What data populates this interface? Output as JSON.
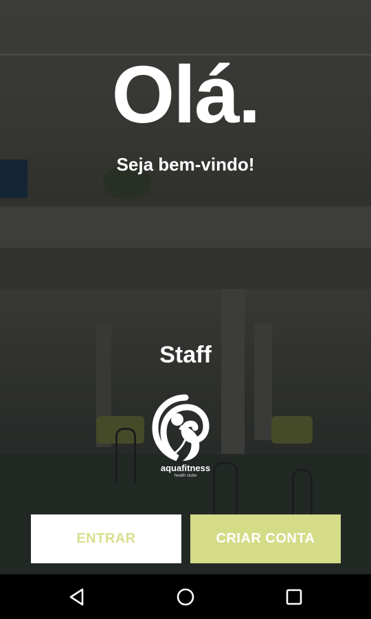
{
  "greeting": "Olá.",
  "welcome": "Seja bem-vindo!",
  "staff_label": "Staff",
  "logo": {
    "name": "aquafitness-logo-icon",
    "text_main": "aquafitness",
    "text_sub": "health clube"
  },
  "buttons": {
    "login_label": "ENTRAR",
    "signup_label": "CRIAR CONTA"
  },
  "colors": {
    "accent": "#d4dc88",
    "login_text": "#d8df8e",
    "text": "#ffffff",
    "navbar": "#000000"
  },
  "navbar": {
    "back_icon": "back-triangle-icon",
    "home_icon": "home-circle-icon",
    "recent_icon": "recent-apps-square-icon"
  }
}
